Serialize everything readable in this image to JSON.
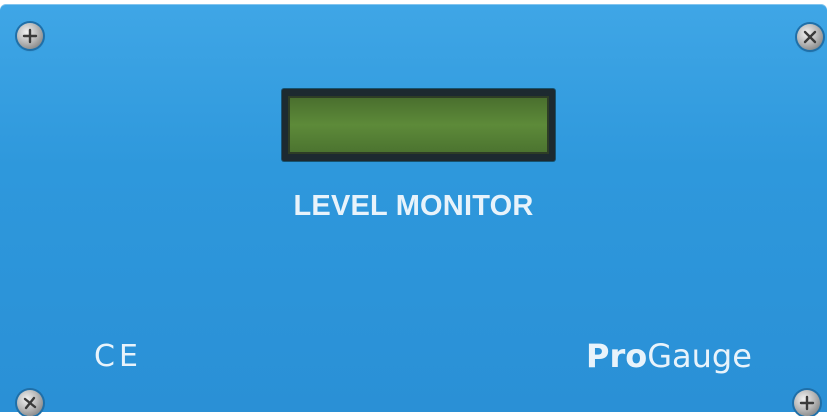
{
  "device": {
    "label": "LEVEL MONITOR",
    "certification_mark": "CE",
    "brand": {
      "prefix": "Pro",
      "suffix": "Gauge"
    },
    "display": {
      "text": ""
    }
  },
  "colors": {
    "panel": "#2e98dc",
    "text": "#e8f3fb",
    "lcd": "#5d8a39"
  },
  "icons": [
    "phillips-screw-icon"
  ]
}
